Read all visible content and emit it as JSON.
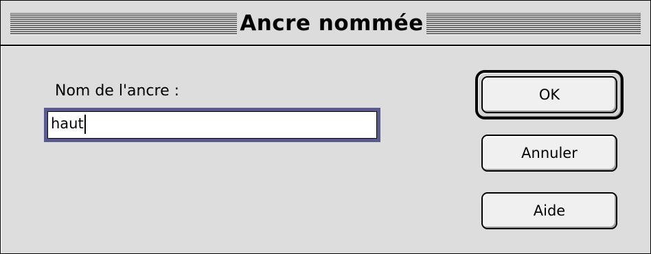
{
  "window": {
    "title": "Ancre nommée"
  },
  "form": {
    "label": "Nom de l'ancre :",
    "value": "haut"
  },
  "buttons": {
    "ok": "OK",
    "cancel": "Annuler",
    "help": "Aide"
  },
  "colors": {
    "background": "#dddddd",
    "focus_ring": "#5a5a8e",
    "text": "#000000"
  }
}
